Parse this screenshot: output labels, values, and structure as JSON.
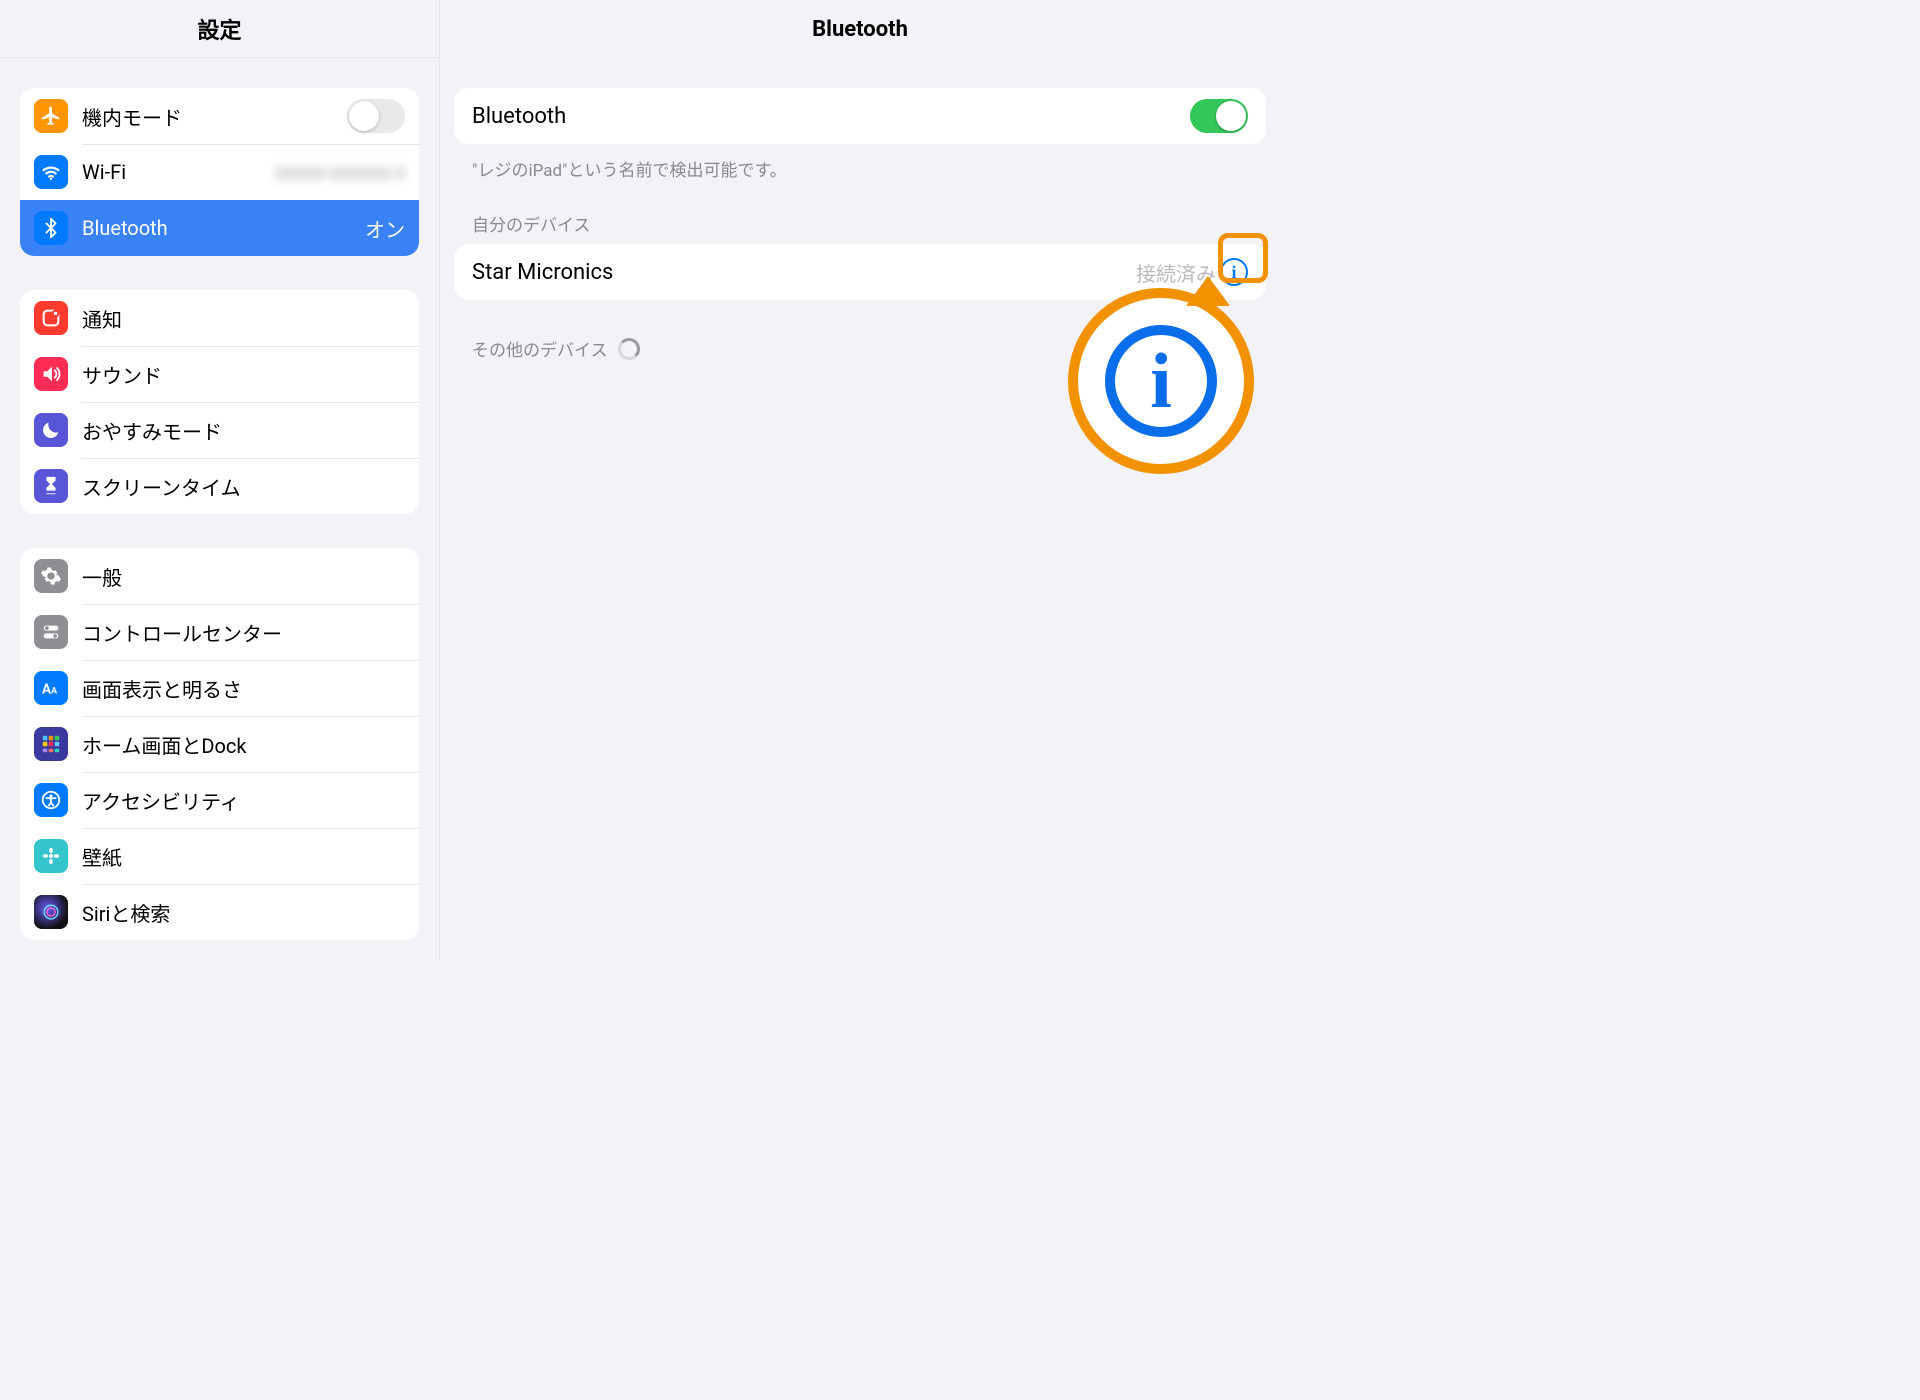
{
  "sidebar": {
    "title": "設定",
    "group1": {
      "airplane": {
        "label": "機内モード",
        "on": false
      },
      "wifi": {
        "label": "Wi-Fi"
      },
      "bluetooth": {
        "label": "Bluetooth",
        "value": "オン"
      }
    },
    "group2": {
      "notifications": {
        "label": "通知"
      },
      "sounds": {
        "label": "サウンド"
      },
      "dnd": {
        "label": "おやすみモード"
      },
      "screentime": {
        "label": "スクリーンタイム"
      }
    },
    "group3": {
      "general": {
        "label": "一般"
      },
      "control": {
        "label": "コントロールセンター"
      },
      "display": {
        "label": "画面表示と明るさ"
      },
      "home": {
        "label": "ホーム画面とDock"
      },
      "access": {
        "label": "アクセシビリティ"
      },
      "wall": {
        "label": "壁紙"
      },
      "siri": {
        "label": "Siriと検索"
      }
    }
  },
  "detail": {
    "title": "Bluetooth",
    "toggle": {
      "label": "Bluetooth",
      "on": true
    },
    "hint": "\"レジのiPad\"という名前で検出可能です。",
    "myDevicesLabel": "自分のデバイス",
    "device": {
      "name": "Star Micronics",
      "status": "接続済み"
    },
    "otherLabel": "その他のデバイス"
  },
  "callout": {
    "letter": "i"
  }
}
